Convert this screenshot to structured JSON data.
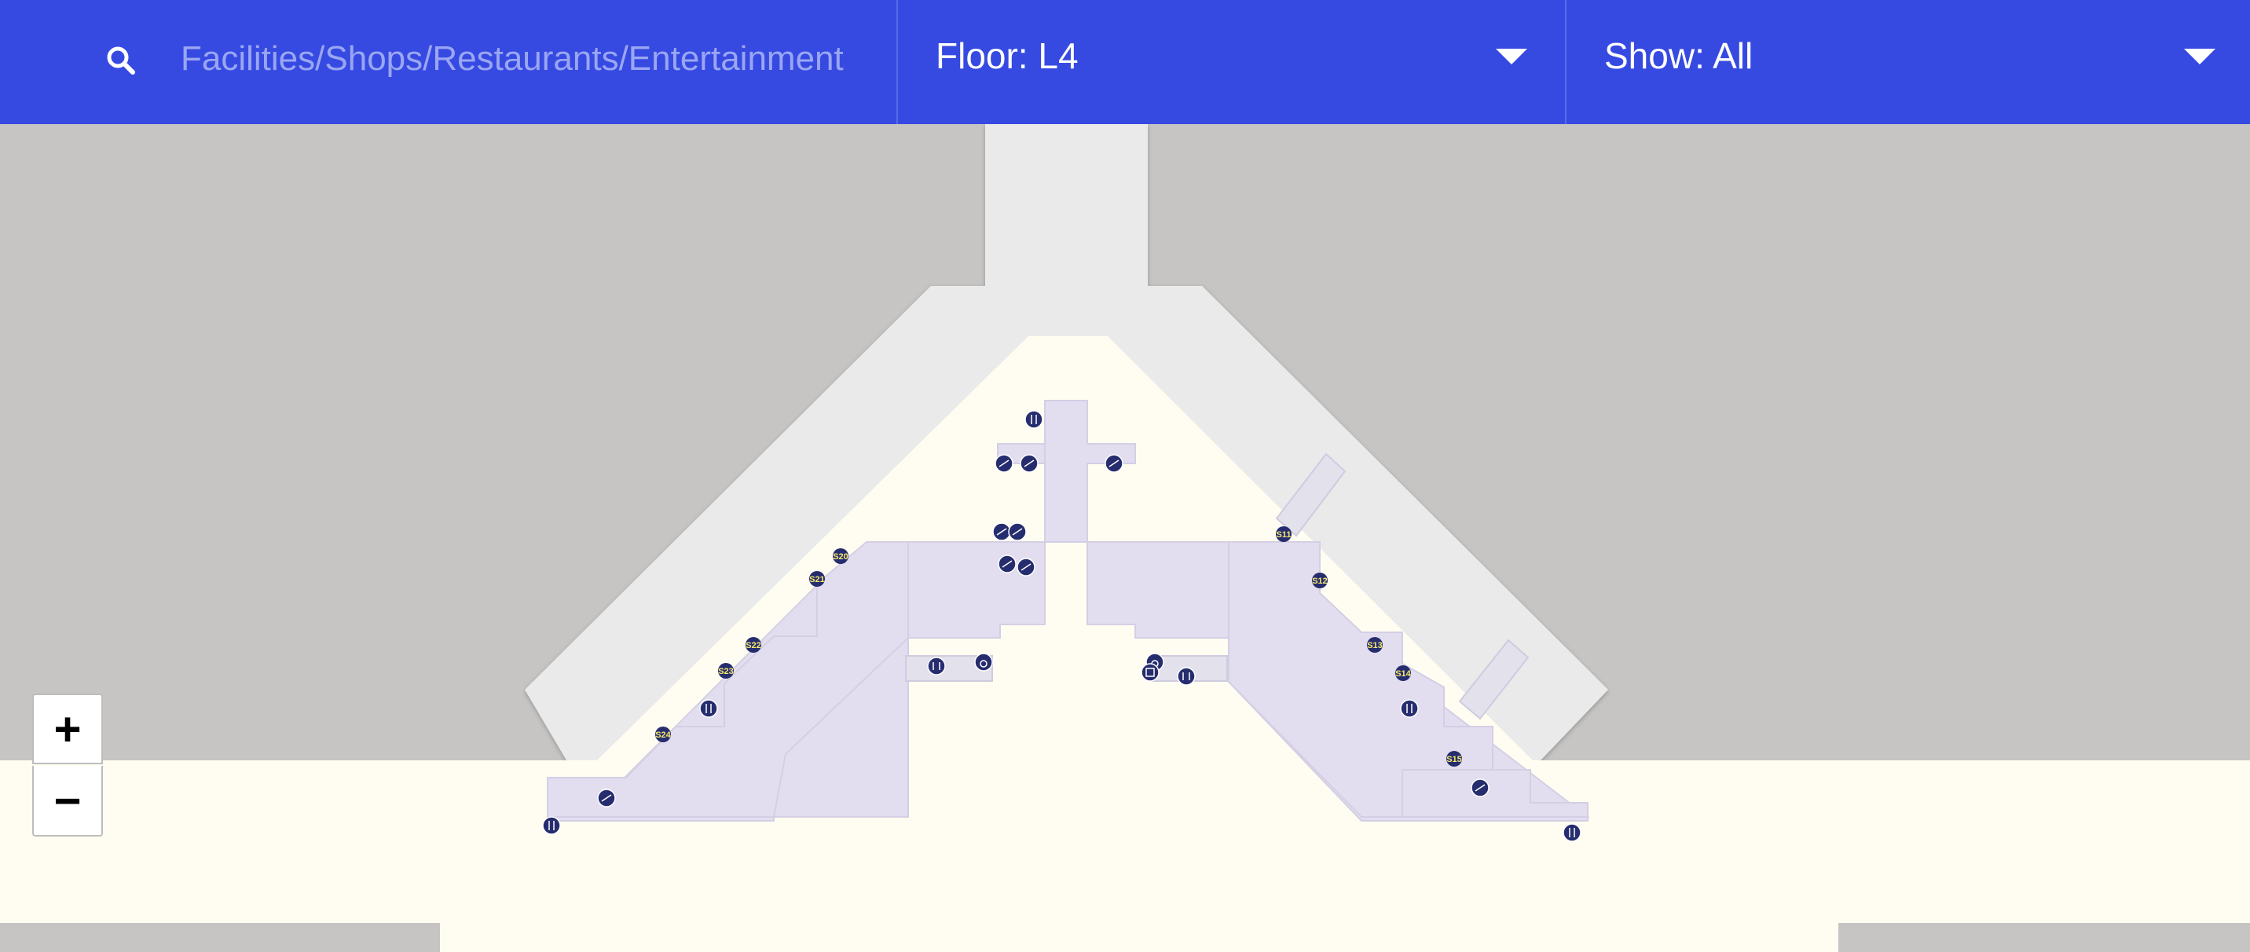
{
  "search": {
    "placeholder": "Facilities/Shops/Restaurants/Entertainment"
  },
  "floor_selector": {
    "label": "Floor: L4"
  },
  "show_selector": {
    "label": "Show: All"
  },
  "zoom": {
    "in_label": "+",
    "out_label": "−"
  },
  "colors": {
    "toolbar": "#364ae2",
    "building": "#fffdf1",
    "shop": "#e2def0",
    "corridor": "#eaeaea",
    "outside": "#c6c5c3",
    "marker": "#262d6e"
  },
  "map": {
    "shop_labels": [
      "S20",
      "S21",
      "S22",
      "S23",
      "S24",
      "S11",
      "S12",
      "S13",
      "S14",
      "S15"
    ],
    "markers": [
      {
        "icon": "restaurant-icon"
      },
      {
        "icon": "escalator-icon"
      },
      {
        "icon": "escalator-icon"
      },
      {
        "icon": "escalator-icon"
      },
      {
        "icon": "escalator-icon"
      },
      {
        "icon": "escalator-icon"
      },
      {
        "icon": "escalator-icon"
      },
      {
        "icon": "escalator-icon"
      },
      {
        "icon": "restroom-icon"
      },
      {
        "icon": "accessible-icon"
      },
      {
        "icon": "accessible-icon"
      },
      {
        "icon": "elevator-icon"
      },
      {
        "icon": "restroom-icon"
      },
      {
        "icon": "restaurant-icon"
      },
      {
        "icon": "escalator-icon"
      },
      {
        "icon": "restaurant-icon"
      },
      {
        "icon": "restaurant-icon"
      },
      {
        "icon": "escalator-icon"
      },
      {
        "icon": "restaurant-icon"
      }
    ]
  }
}
